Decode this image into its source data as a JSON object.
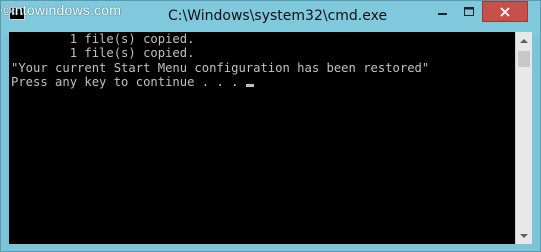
{
  "watermark": "©intowindows.com",
  "window": {
    "title": "C:\\Windows\\system32\\cmd.exe",
    "icon_text": "C:\\."
  },
  "console": {
    "lines": [
      "        1 file(s) copied.",
      "        1 file(s) copied.",
      "\"Your current Start Menu configuration has been restored\"",
      "Press any key to continue . . . "
    ]
  },
  "colors": {
    "titlebar": "#80c8dc",
    "close_button": "#c7504a",
    "console_bg": "#000000",
    "console_fg": "#c0c0c0"
  },
  "icons": {
    "app": "cmd-icon",
    "minimize": "minimize-icon",
    "maximize": "maximize-icon",
    "close": "close-icon",
    "scroll_up": "scroll-up-arrow-icon",
    "scroll_down": "scroll-down-arrow-icon"
  }
}
